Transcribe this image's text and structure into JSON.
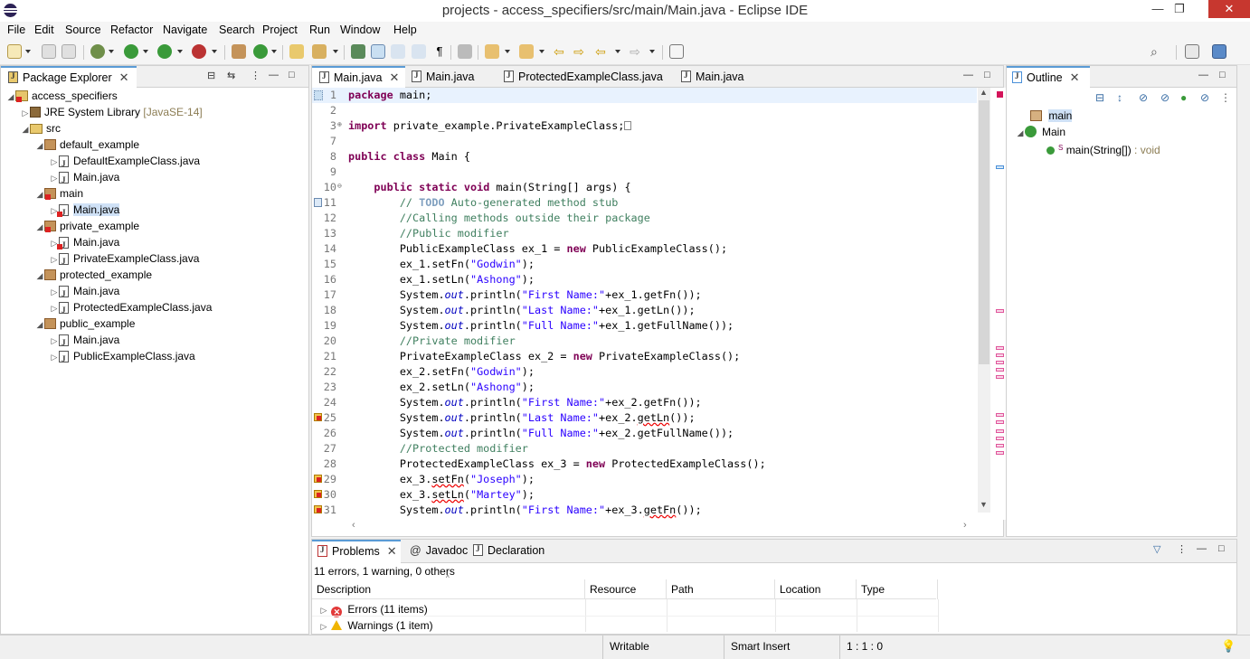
{
  "window": {
    "title": "projects - access_specifiers/src/main/Main.java - Eclipse IDE",
    "minimize": "—",
    "maximize": "❐",
    "close": "✕"
  },
  "menu": [
    "File",
    "Edit",
    "Source",
    "Refactor",
    "Navigate",
    "Search",
    "Project",
    "Run",
    "Window",
    "Help"
  ],
  "package_explorer": {
    "title": "Package Explorer",
    "items": [
      {
        "label": "access_specifiers",
        "suffix": ""
      },
      {
        "label": "JRE System Library",
        "suffix": "[JavaSE-14]"
      },
      {
        "label": "src",
        "suffix": ""
      },
      {
        "label": "default_example",
        "suffix": ""
      },
      {
        "label": "DefaultExampleClass.java",
        "suffix": ""
      },
      {
        "label": "Main.java",
        "suffix": ""
      },
      {
        "label": "main",
        "suffix": ""
      },
      {
        "label": "Main.java",
        "suffix": ""
      },
      {
        "label": "private_example",
        "suffix": ""
      },
      {
        "label": "Main.java",
        "suffix": ""
      },
      {
        "label": "PrivateExampleClass.java",
        "suffix": ""
      },
      {
        "label": "protected_example",
        "suffix": ""
      },
      {
        "label": "Main.java",
        "suffix": ""
      },
      {
        "label": "ProtectedExampleClass.java",
        "suffix": ""
      },
      {
        "label": "public_example",
        "suffix": ""
      },
      {
        "label": "Main.java",
        "suffix": ""
      },
      {
        "label": "PublicExampleClass.java",
        "suffix": ""
      }
    ]
  },
  "editor": {
    "tabs": [
      "Main.java",
      "Main.java",
      "ProtectedExampleClass.java",
      "Main.java"
    ],
    "lines": [
      {
        "n": "1"
      },
      {
        "n": "2"
      },
      {
        "n": "3"
      },
      {
        "n": "7"
      },
      {
        "n": "8"
      },
      {
        "n": "9"
      },
      {
        "n": "10"
      },
      {
        "n": "11"
      },
      {
        "n": "12"
      },
      {
        "n": "13"
      },
      {
        "n": "14"
      },
      {
        "n": "15"
      },
      {
        "n": "16"
      },
      {
        "n": "17"
      },
      {
        "n": "18"
      },
      {
        "n": "19"
      },
      {
        "n": "20"
      },
      {
        "n": "21"
      },
      {
        "n": "22"
      },
      {
        "n": "23"
      },
      {
        "n": "24"
      },
      {
        "n": "25"
      },
      {
        "n": "26"
      },
      {
        "n": "27"
      },
      {
        "n": "28"
      },
      {
        "n": "29"
      },
      {
        "n": "30"
      },
      {
        "n": "31"
      }
    ],
    "code": {
      "l1_kw": "package",
      "l1_rest": " main;",
      "l3_kw": "import",
      "l3_rest": " private_example.PrivateExampleClass;",
      "l8_kw1": "public",
      "l8_kw2": "class",
      "l8_rest": " Main {",
      "l10_kw1": "public",
      "l10_kw2": "static",
      "l10_kw3": "void",
      "l10_rest": " main(String[] args) {",
      "l11_a": "// ",
      "l11_todo": "TODO",
      "l11_b": " Auto-generated method stub",
      "l12": "//Calling methods outside their package",
      "l13": "//Public modifier",
      "l14_a": "PublicExampleClass ex_1 = ",
      "l14_kw": "new",
      "l14_b": " PublicExampleClass();",
      "l15_a": "ex_1.setFn(",
      "l15_s": "\"Godwin\"",
      "l15_b": ");",
      "l16_a": "ex_1.setLn(",
      "l16_s": "\"Ashong\"",
      "l16_b": ");",
      "l17_a": "System.",
      "l17_f": "out",
      "l17_b": ".println(",
      "l17_s": "\"First Name:\"",
      "l17_c": "+ex_1.getFn());",
      "l18_a": "System.",
      "l18_f": "out",
      "l18_b": ".println(",
      "l18_s": "\"Last Name:\"",
      "l18_c": "+ex_1.getLn());",
      "l19_a": "System.",
      "l19_f": "out",
      "l19_b": ".println(",
      "l19_s": "\"Full Name:\"",
      "l19_c": "+ex_1.getFullName());",
      "l20": "//Private modifier",
      "l21_a": "PrivateExampleClass ex_2 = ",
      "l21_kw": "new",
      "l21_b": " PrivateExampleClass();",
      "l22_a": "ex_2.setFn(",
      "l22_s": "\"Godwin\"",
      "l22_b": ");",
      "l23_a": "ex_2.setLn(",
      "l23_s": "\"Ashong\"",
      "l23_b": ");",
      "l24_a": "System.",
      "l24_f": "out",
      "l24_b": ".println(",
      "l24_s": "\"First Name:\"",
      "l24_c": "+ex_2.getFn());",
      "l25_a": "System.",
      "l25_f": "out",
      "l25_b": ".println(",
      "l25_s": "\"Last Name:\"",
      "l25_c": "+ex_2.",
      "l25_sq": "getLn",
      "l25_d": "());",
      "l26_a": "System.",
      "l26_f": "out",
      "l26_b": ".println(",
      "l26_s": "\"Full Name:\"",
      "l26_c": "+ex_2.getFullName());",
      "l27": "//Protected modifier",
      "l28_a": "ProtectedExampleClass ex_3 = ",
      "l28_kw": "new",
      "l28_b": " ProtectedExampleClass();",
      "l29_a": "ex_3.",
      "l29_sq": "setFn",
      "l29_b": "(",
      "l29_s": "\"Joseph\"",
      "l29_c": ");",
      "l30_a": "ex_3.",
      "l30_sq": "setLn",
      "l30_b": "(",
      "l30_s": "\"Martey\"",
      "l30_c": ");",
      "l31_a": "System.",
      "l31_f": "out",
      "l31_b": ".println(",
      "l31_s": "\"First Name:\"",
      "l31_c": "+ex_3.",
      "l31_sq": "getFn",
      "l31_d": "());"
    }
  },
  "outline": {
    "title": "Outline",
    "items": [
      "main",
      "Main",
      "main(String[])",
      " : void"
    ]
  },
  "problems": {
    "tabs": [
      "Problems",
      "Javadoc",
      "Declaration"
    ],
    "summary": "11 errors, 1 warning, 0 others",
    "columns": [
      "Description",
      "Resource",
      "Path",
      "Location",
      "Type"
    ],
    "rows": [
      "Errors (11 items)",
      "Warnings (1 item)"
    ]
  },
  "status": {
    "writable": "Writable",
    "insert_mode": "Smart Insert",
    "position": "1 : 1 : 0"
  },
  "colors": {
    "keyword": "#7f0055",
    "comment": "#3f7f5f",
    "string": "#2a00ff",
    "field": "#0000c0",
    "active_tab": "#5a9bd5"
  }
}
